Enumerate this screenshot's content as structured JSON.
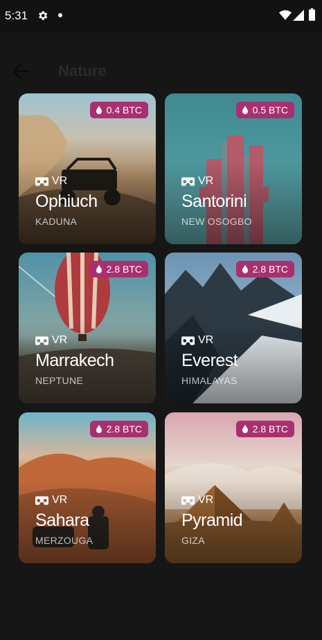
{
  "status_bar": {
    "time": "5:31"
  },
  "header": {
    "title": "Nature"
  },
  "cards": [
    {
      "price": "0.4 BTC",
      "vr_label": "VR",
      "name": "Ophiuch",
      "location": "KADUNA"
    },
    {
      "price": "0.5 BTC",
      "vr_label": "VR",
      "name": "Santorini",
      "location": "NEW OSOGBO"
    },
    {
      "price": "2.8 BTC",
      "vr_label": "VR",
      "name": "Marrakech",
      "location": "NEPTUNE"
    },
    {
      "price": "2.8 BTC",
      "vr_label": "VR",
      "name": "Everest",
      "location": "HIMALAYAS"
    },
    {
      "price": "2.8 BTC",
      "vr_label": "VR",
      "name": "Sahara",
      "location": "MERZOUGA"
    },
    {
      "price": "2.8 BTC",
      "vr_label": "VR",
      "name": "Pyramid",
      "location": "GIZA"
    }
  ],
  "colors": {
    "badge": "#a83070",
    "background": "#161616"
  },
  "icons": [
    "gear-icon",
    "wifi-icon",
    "signal-icon",
    "battery-icon",
    "back-arrow-icon",
    "flame-icon",
    "vr-headset-icon"
  ]
}
